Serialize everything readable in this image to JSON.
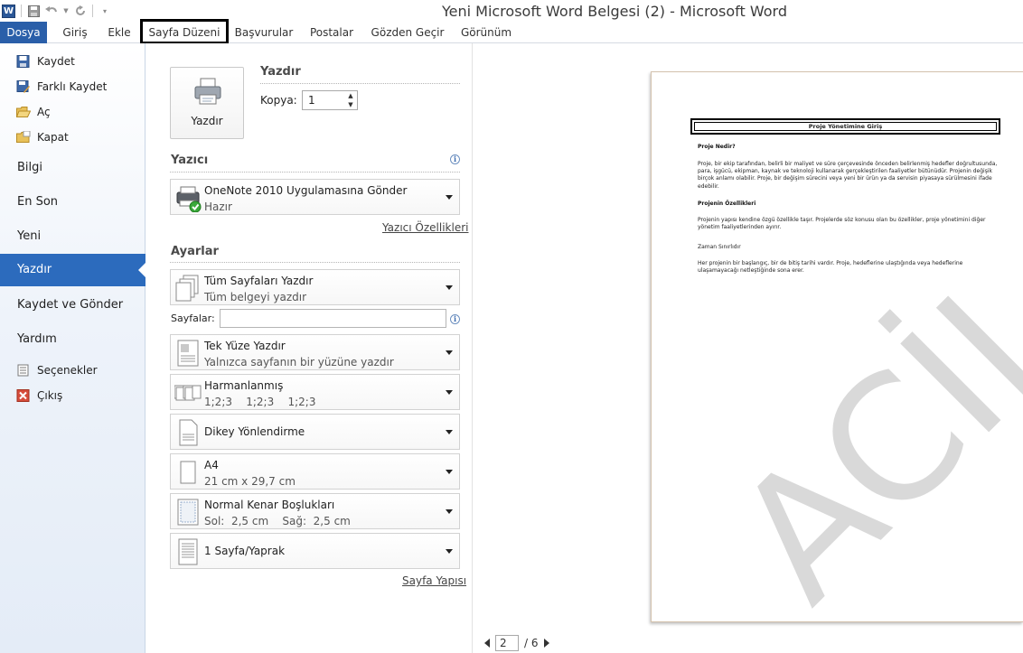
{
  "window": {
    "title": "Yeni Microsoft Word Belgesi (2)  -  Microsoft Word",
    "app_icon": "W"
  },
  "quick_access": {
    "icons": [
      "word-icon",
      "save-icon",
      "undo-icon",
      "redo-icon",
      "customize-icon"
    ]
  },
  "ribbon": {
    "tabs": [
      "Dosya",
      "Giriş",
      "Ekle",
      "Sayfa Düzeni",
      "Başvurular",
      "Postalar",
      "Gözden Geçir",
      "Görünüm"
    ],
    "highlighted_tab": "Sayfa Düzeni"
  },
  "nav": {
    "commands": [
      {
        "label": "Kaydet",
        "icon": "save-icon"
      },
      {
        "label": "Farklı Kaydet",
        "icon": "save-as-icon"
      },
      {
        "label": "Aç",
        "icon": "open-folder-icon"
      },
      {
        "label": "Kapat",
        "icon": "close-folder-icon"
      }
    ],
    "sections": [
      "Bilgi",
      "En Son",
      "Yeni",
      "Yazdır",
      "Kaydet ve Gönder",
      "Yardım"
    ],
    "active": "Yazdır",
    "bottom": [
      {
        "label": "Seçenekler",
        "icon": "options-icon"
      },
      {
        "label": "Çıkış",
        "icon": "exit-icon"
      }
    ]
  },
  "print": {
    "section_title": "Yazdır",
    "button_label": "Yazdır",
    "copies_label": "Kopya:",
    "copies_value": "1"
  },
  "printer": {
    "section_title": "Yazıcı",
    "name": "OneNote 2010 Uygulamasına Gönder",
    "status": "Hazır",
    "properties_link": "Yazıcı Özellikleri"
  },
  "settings": {
    "section_title": "Ayarlar",
    "pages_label": "Sayfalar:",
    "pages_value": "",
    "items": [
      {
        "main": "Tüm Sayfaları Yazdır",
        "sub": "Tüm belgeyi yazdır"
      },
      {
        "main": "Tek Yüze Yazdır",
        "sub": "Yalnızca sayfanın bir yüzüne yazdır"
      },
      {
        "main": "Harmanlanmış",
        "sub": "1;2;3    1;2;3    1;2;3"
      },
      {
        "main": "Dikey Yönlendirme",
        "sub": ""
      },
      {
        "main": "A4",
        "sub": "21 cm x 29,7 cm"
      },
      {
        "main": "Normal Kenar Boşlukları",
        "sub": "Sol:  2,5 cm    Sağ:  2,5 cm"
      },
      {
        "main": "1 Sayfa/Yaprak",
        "sub": ""
      }
    ],
    "page_setup_link": "Sayfa Yapısı"
  },
  "document": {
    "title": "Proje Yönetimine Giriş",
    "h1": "Proje Nedir?",
    "p1": "Proje, bir ekip tarafından, belirli bir maliyet ve süre çerçevesinde önceden belirlenmiş hedefler doğrultusunda, para, işgücü, ekipman, kaynak ve teknoloji kullanarak gerçekleştirilen faaliyetler bütünüdür. Projenin değişik birçok anlamı olabilir. Proje, bir değişim sürecini veya yeni bir ürün ya da servisin piyasaya sürülmesini ifade edebilir.",
    "h2": "Projenin Özellikleri",
    "p2": "Projenin yapısı kendine özgü özellikle taşır. Projelerde söz konusu olan bu özellikler, proje yönetimini diğer yönetim faaliyetlerinden ayırır.",
    "s1": "Zaman Sınırlıdır",
    "p3": "Her projenin bir başlangıç, bir de bitiş tarihi vardır. Proje, hedeflerine ulaştığında veya hedeflerine ulaşamayacağı netleştiğinde sona erer.",
    "watermark": "ACİL"
  },
  "pager": {
    "current": "2",
    "total": "/ 6"
  }
}
